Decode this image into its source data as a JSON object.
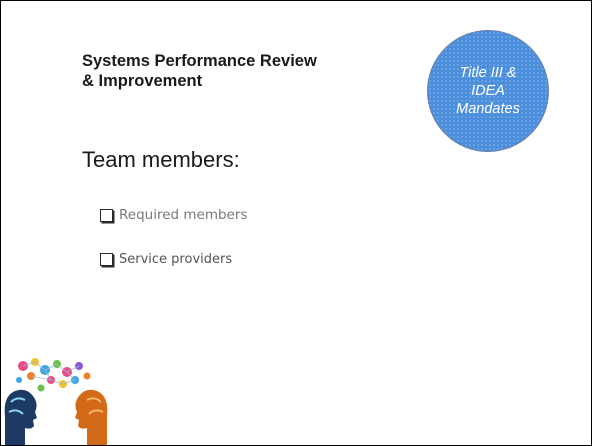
{
  "slide": {
    "title": "Systems Performance Review\n& Improvement",
    "badge": {
      "lines": [
        "Title III &",
        "IDEA",
        "Mandates"
      ],
      "color": "#4b8fdc"
    },
    "heading": "Team members:",
    "checklist": [
      {
        "label": "Required members",
        "checked": false
      },
      {
        "label": "Service providers",
        "checked": false
      }
    ],
    "illustration": "two-heads-brainstorm-icon"
  }
}
